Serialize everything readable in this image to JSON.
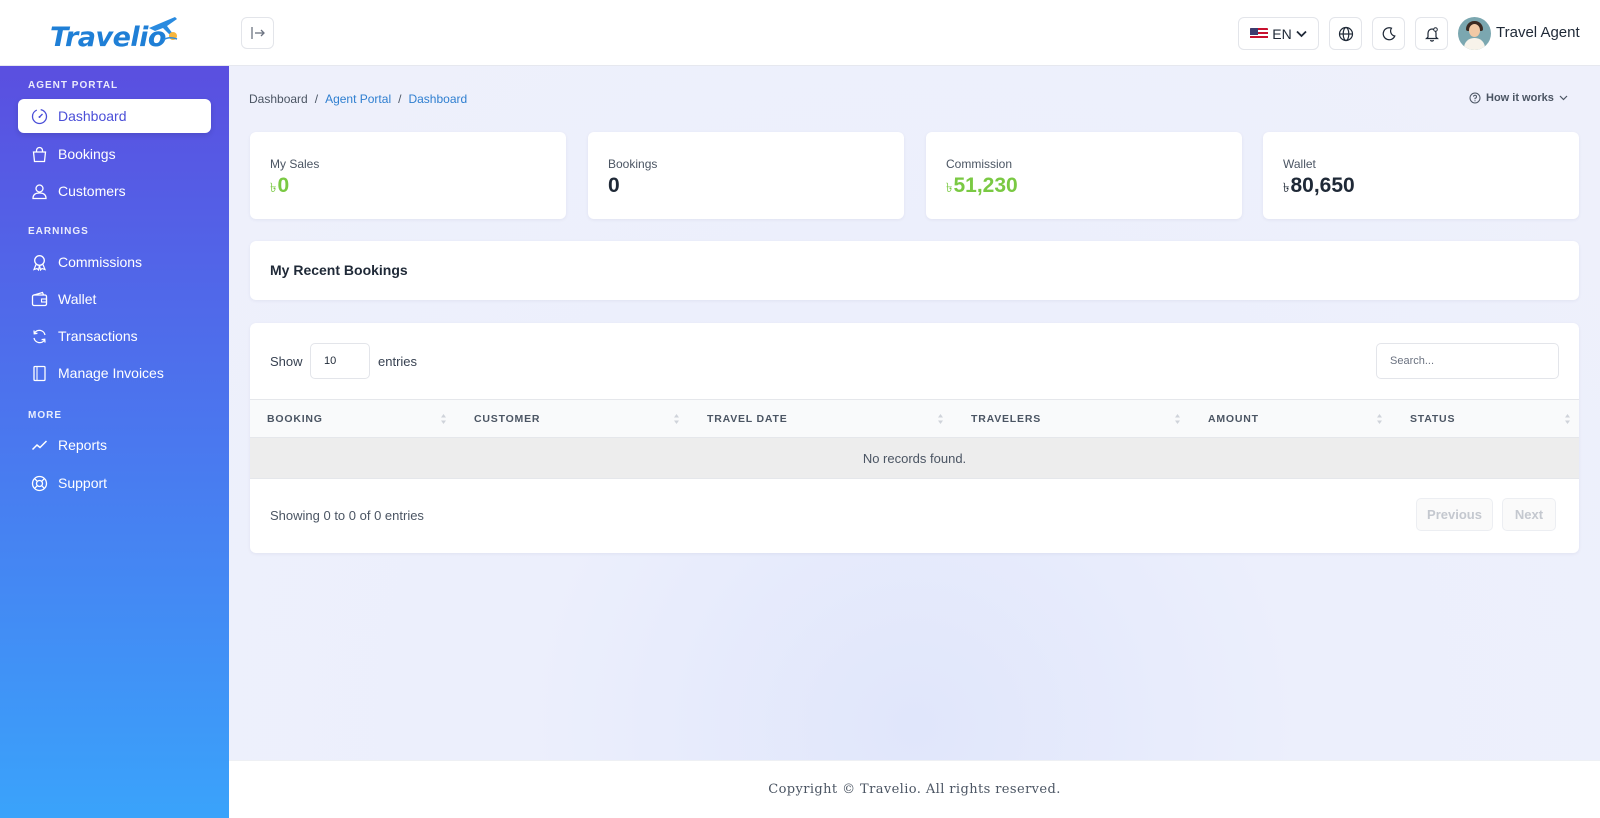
{
  "brand": {
    "name": "Travelio",
    "logo_color": "#1f7fd6"
  },
  "header": {
    "language": "EN",
    "language_flag": "us-flag-icon",
    "icons": [
      "sidebar-collapse-icon",
      "globe-icon",
      "moon-icon",
      "bell-icon"
    ],
    "user_name": "Travel Agent"
  },
  "sidebar": {
    "sections": [
      {
        "title": "AGENT PORTAL",
        "items": [
          {
            "label": "Dashboard",
            "icon": "speedometer-icon",
            "active": true
          },
          {
            "label": "Bookings",
            "icon": "shopping-bag-icon"
          },
          {
            "label": "Customers",
            "icon": "user-icon"
          }
        ]
      },
      {
        "title": "EARNINGS",
        "items": [
          {
            "label": "Commissions",
            "icon": "award-icon"
          },
          {
            "label": "Wallet",
            "icon": "wallet-icon"
          },
          {
            "label": "Transactions",
            "icon": "refresh-icon"
          },
          {
            "label": "Manage Invoices",
            "icon": "invoice-icon"
          }
        ]
      },
      {
        "title": "MORE",
        "items": [
          {
            "label": "Reports",
            "icon": "trend-line-icon"
          },
          {
            "label": "Support",
            "icon": "lifebuoy-icon"
          }
        ]
      }
    ],
    "gradient": [
      "#5a4fe0",
      "#3aa3fb"
    ]
  },
  "breadcrumb": [
    "Dashboard",
    "Agent Portal",
    "Dashboard"
  ],
  "how_it_works": "How it works",
  "stats": [
    {
      "label": "My Sales",
      "currency": "৳",
      "value": "0",
      "color": "#7ac943"
    },
    {
      "label": "Bookings",
      "currency": "",
      "value": "0",
      "color": "#1f2937"
    },
    {
      "label": "Commission",
      "currency": "৳",
      "value": "51,230",
      "color": "#7ac943"
    },
    {
      "label": "Wallet",
      "currency": "৳",
      "value": "80,650",
      "color": "#1f2937"
    }
  ],
  "recent_bookings": {
    "title": "My Recent Bookings",
    "show_label": "Show",
    "entries_value": "10",
    "entries_label": "entries",
    "search_placeholder": "Search...",
    "columns": [
      "BOOKING",
      "CUSTOMER",
      "TRAVEL DATE",
      "TRAVELERS",
      "AMOUNT",
      "STATUS"
    ],
    "rows": [],
    "empty_message": "No records found.",
    "showing_text": "Showing 0 to 0 of 0 entries",
    "prev_label": "Previous",
    "next_label": "Next"
  },
  "footer": {
    "copyright": "Copyright © Travelio. All rights reserved."
  }
}
